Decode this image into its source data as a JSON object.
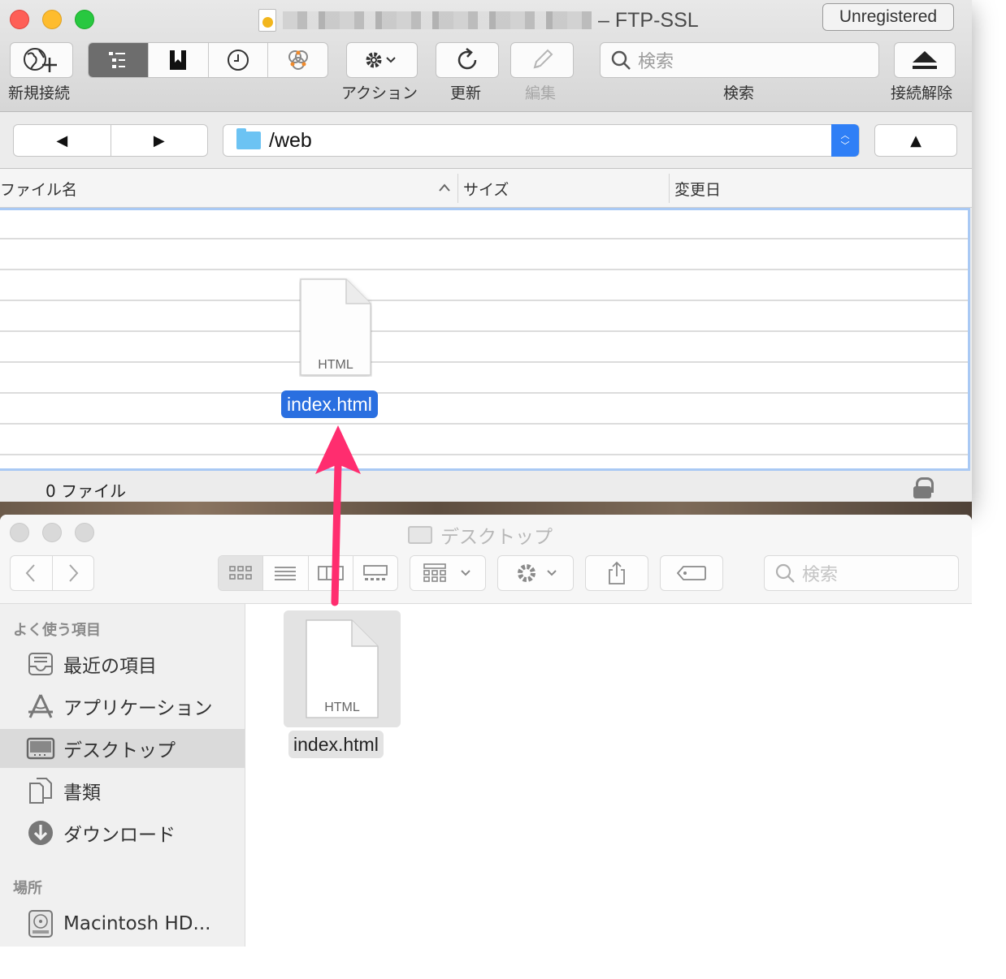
{
  "ftp_window": {
    "title_suffix": "– FTP-SSL",
    "registration_button": "Unregistered",
    "toolbar": {
      "new_connection": "新規接続",
      "action": "アクション",
      "refresh": "更新",
      "edit": "編集",
      "search_placeholder": "検索",
      "search_label": "検索",
      "disconnect": "接続解除"
    },
    "nav": {
      "back": "◀",
      "forward": "▶",
      "up": "▲"
    },
    "path": "/web",
    "columns": {
      "name": "ファイル名",
      "size": "サイズ",
      "modified": "変更日"
    },
    "status_count": "0 ファイル",
    "dragged_file": {
      "name": "index.html",
      "type": "HTML"
    }
  },
  "finder_window": {
    "title": "デスクトップ",
    "search_placeholder": "検索",
    "sidebar": {
      "favorites_header": "よく使う項目",
      "items": [
        {
          "label": "最近の項目",
          "icon": "recents-icon"
        },
        {
          "label": "アプリケーション",
          "icon": "applications-icon"
        },
        {
          "label": "デスクトップ",
          "icon": "desktop-icon",
          "selected": true
        },
        {
          "label": "書類",
          "icon": "documents-icon"
        },
        {
          "label": "ダウンロード",
          "icon": "downloads-icon"
        }
      ],
      "locations_header": "場所",
      "locations": [
        {
          "label": "Macintosh HD...",
          "icon": "hard-drive-icon"
        }
      ]
    },
    "file": {
      "name": "index.html",
      "type": "HTML"
    }
  },
  "colors": {
    "arrow": "#ff2d6f",
    "selection": "#2a6fe0",
    "drop_highlight": "#a9c9f4"
  }
}
